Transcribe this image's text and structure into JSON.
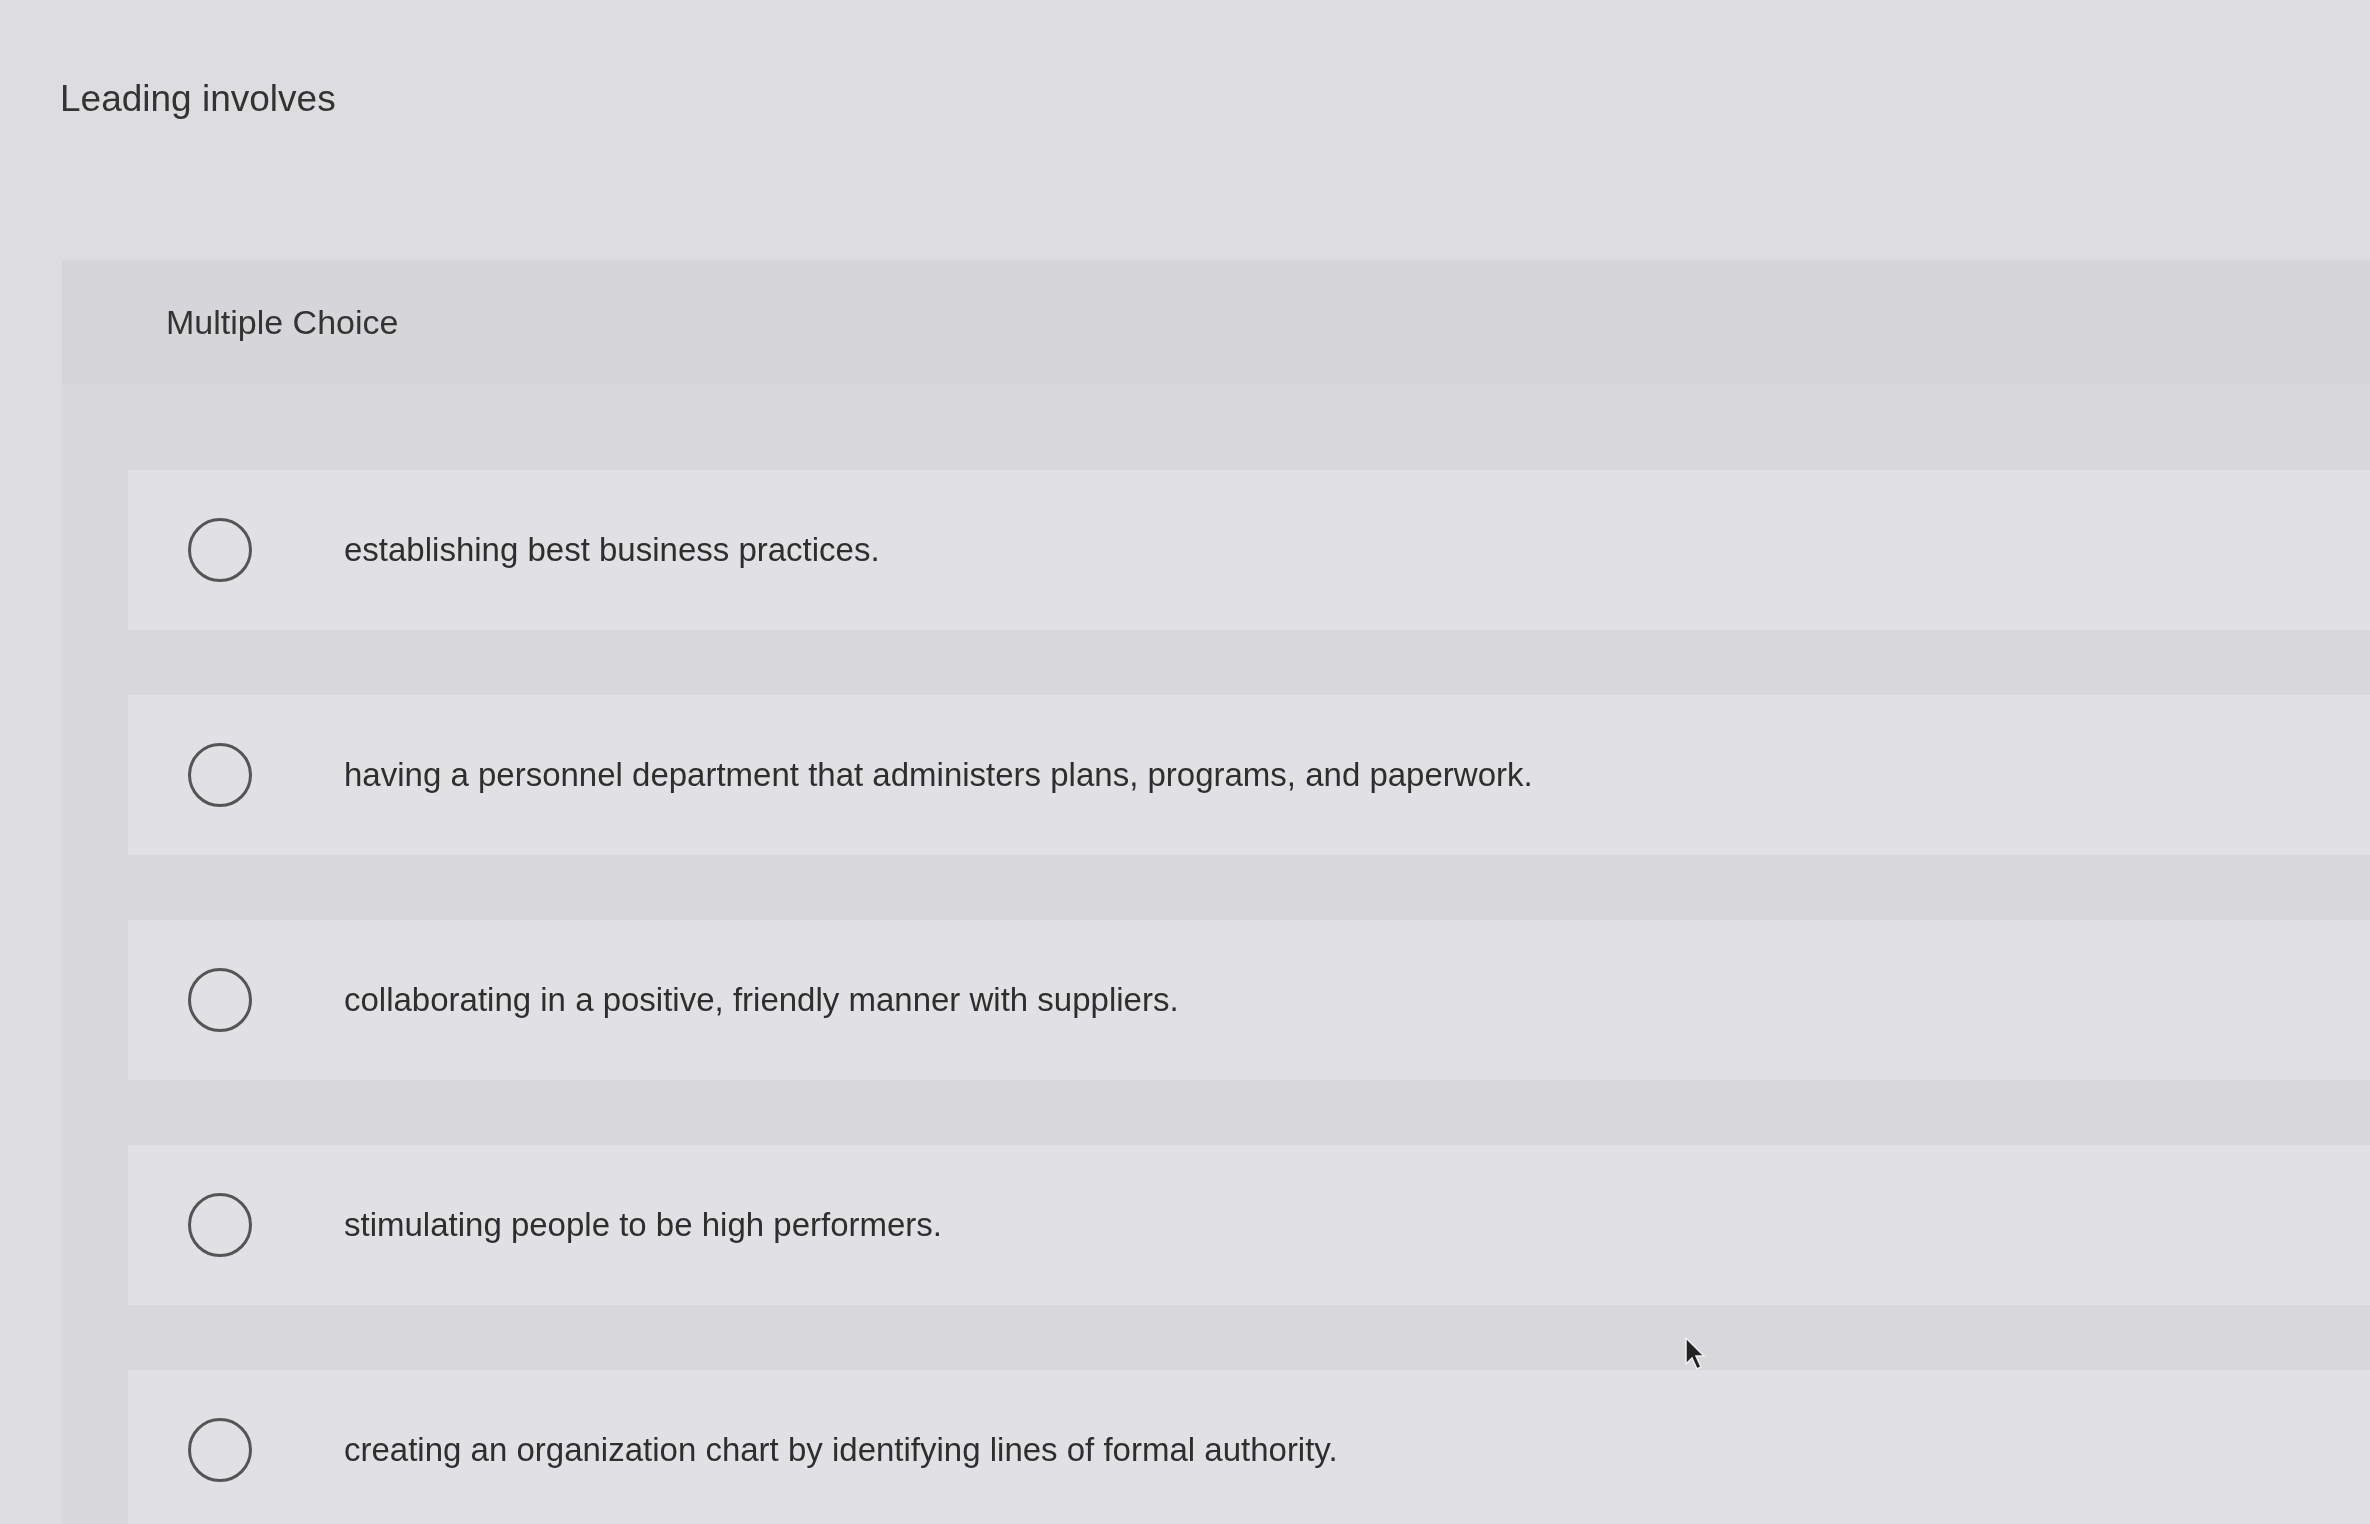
{
  "question": {
    "text": "Leading involves"
  },
  "panel": {
    "header": "Multiple Choice",
    "options": [
      {
        "label": "establishing best business practices.",
        "selected": false
      },
      {
        "label": "having a personnel department that administers plans, programs, and paperwork.",
        "selected": false
      },
      {
        "label": "collaborating in a positive, friendly manner with suppliers.",
        "selected": false
      },
      {
        "label": "stimulating people to be high performers.",
        "selected": false
      },
      {
        "label": "creating an organization chart by identifying lines of formal authority.",
        "selected": false
      }
    ]
  }
}
